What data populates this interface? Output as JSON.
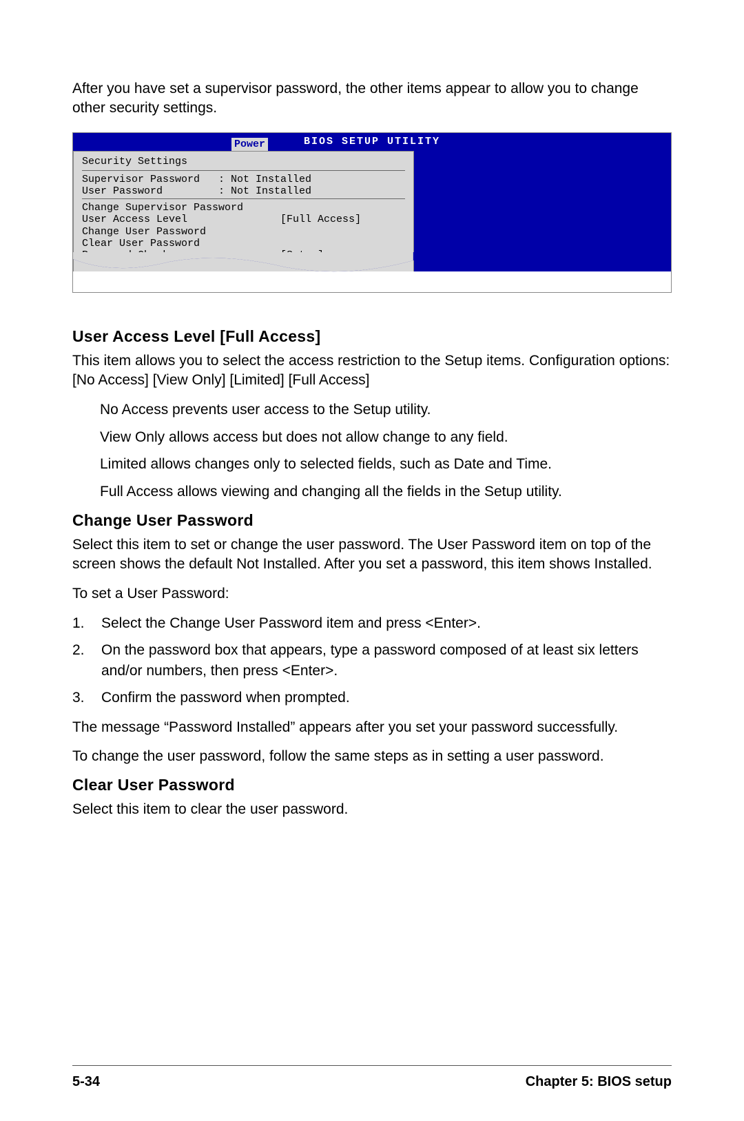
{
  "intro": "After you have set a supervisor password, the other items appear to allow you to change other security settings.",
  "bios": {
    "title": "BIOS SETUP UTILITY",
    "tab": "Power",
    "section_heading": "Security Settings",
    "status_rows": [
      "Supervisor Password   : Not Installed",
      "User Password         : Not Installed"
    ],
    "menu_rows": [
      "Change Supervisor Password",
      "User Access Level               [Full Access]",
      "Change User Password",
      "Clear User Password",
      "Password Check                  [Setup]"
    ]
  },
  "sections": {
    "ual_heading": "User Access Level [Full Access]",
    "ual_p1": "This item allows you to select the access restriction to the Setup items. Configuration options: [No Access] [View Only] [Limited] [Full Access]",
    "ual_opts": [
      "No Access prevents user access to the Setup utility.",
      "View Only allows access but does not allow change to any field.",
      "Limited allows changes only to selected fields, such as Date and Time.",
      "Full Access allows viewing and changing all the fields in the Setup utility."
    ],
    "cup_heading": "Change User Password",
    "cup_p1": "Select this item to set or change the user password. The User Password item on top of the screen shows the default Not Installed. After you set a password, this item shows Installed.",
    "cup_p2": "To set a User Password:",
    "cup_steps": [
      "Select the Change User Password item and press <Enter>.",
      "On the password box that appears, type a password composed of at least six letters and/or numbers, then press <Enter>.",
      "Confirm the password when prompted."
    ],
    "cup_p3": "The message “Password Installed” appears after you set your password successfully.",
    "cup_p4": "To change the user password, follow the same steps as in setting a user password.",
    "clup_heading": "Clear User Password",
    "clup_p1": "Select this item to clear the user password."
  },
  "footer": {
    "page": "5-34",
    "chapter": "Chapter 5: BIOS setup"
  }
}
